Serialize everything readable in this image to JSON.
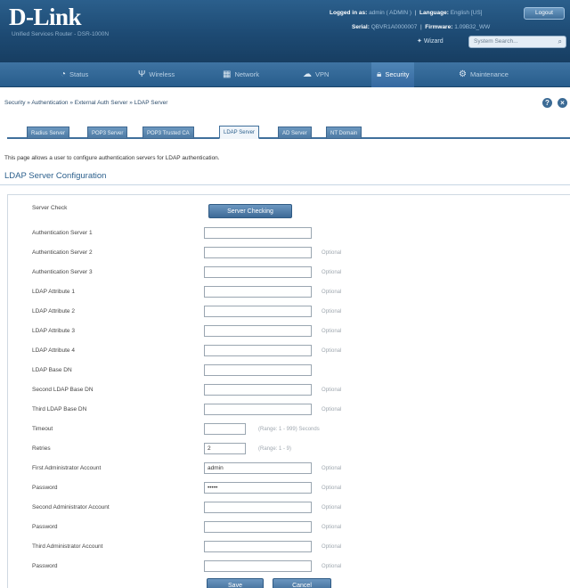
{
  "header": {
    "logo": "D-Link",
    "logo_sub": "Unified Services Router - DSR-1000N",
    "logged_in_label": "Logged in as:",
    "logged_in_value": "admin ( ADMIN )",
    "language_label": "Language:",
    "language_value": "English [US]",
    "logout_label": "Logout",
    "serial_label": "Serial:",
    "serial_value": "QBVR1A0000007",
    "firmware_label": "Firmware:",
    "firmware_value": "1.09B32_WW",
    "wizard_label": "Wizard",
    "search_placeholder": "System Search..."
  },
  "nav": {
    "items": [
      {
        "label": "Status",
        "icon": "gauge-icon"
      },
      {
        "label": "Wireless",
        "icon": "antenna-icon"
      },
      {
        "label": "Network",
        "icon": "network-icon"
      },
      {
        "label": "VPN",
        "icon": "cloud-icon"
      },
      {
        "label": "Security",
        "icon": "lock-icon"
      },
      {
        "label": "Maintenance",
        "icon": "gear-icon"
      }
    ],
    "active": "Security"
  },
  "breadcrumb": "Security  »  Authentication  »  External Auth Server  »  LDAP Server",
  "tabs": [
    {
      "label": "Radius Server"
    },
    {
      "label": "POP3 Server"
    },
    {
      "label": "POP3 Trusted CA"
    },
    {
      "label": "LDAP Server"
    },
    {
      "label": "AD Server"
    },
    {
      "label": "NT Domain"
    }
  ],
  "active_tab": "LDAP Server",
  "description": "This page allows a user to configure authentication servers for LDAP authentication.",
  "section_title": "LDAP Server Configuration",
  "form": {
    "server_check_label": "Server Check",
    "server_check_button": "Server Checking",
    "fields": [
      {
        "label": "Authentication Server 1",
        "value": "",
        "hint": ""
      },
      {
        "label": "Authentication Server 2",
        "value": "",
        "hint": "Optional"
      },
      {
        "label": "Authentication Server 3",
        "value": "",
        "hint": "Optional"
      },
      {
        "label": "LDAP Attribute 1",
        "value": "",
        "hint": "Optional"
      },
      {
        "label": "LDAP Attribute 2",
        "value": "",
        "hint": "Optional"
      },
      {
        "label": "LDAP Attribute 3",
        "value": "",
        "hint": "Optional"
      },
      {
        "label": "LDAP Attribute 4",
        "value": "",
        "hint": "Optional"
      },
      {
        "label": "LDAP Base DN",
        "value": "",
        "hint": ""
      },
      {
        "label": "Second LDAP Base DN",
        "value": "",
        "hint": "Optional"
      },
      {
        "label": "Third LDAP Base DN",
        "value": "",
        "hint": "Optional"
      },
      {
        "label": "Timeout",
        "value": "",
        "hint": "(Range: 1 - 999) Seconds"
      },
      {
        "label": "Retries",
        "value": "2",
        "hint": "(Range: 1 - 9)"
      },
      {
        "label": "First Administrator Account",
        "value": "admin",
        "hint": "Optional"
      },
      {
        "label": "Password",
        "value": "•••••",
        "hint": "Optional"
      },
      {
        "label": "Second Administrator Account",
        "value": "",
        "hint": "Optional"
      },
      {
        "label": "Password",
        "value": "",
        "hint": "Optional"
      },
      {
        "label": "Third Administrator Account",
        "value": "",
        "hint": "Optional"
      },
      {
        "label": "Password",
        "value": "",
        "hint": "Optional"
      }
    ],
    "save_button": "Save",
    "cancel_button": "Cancel"
  }
}
